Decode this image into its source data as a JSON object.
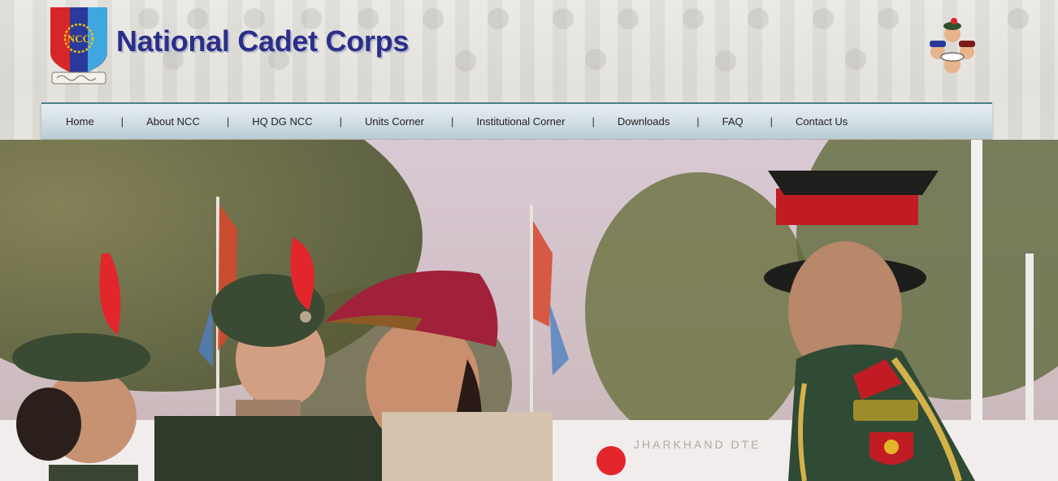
{
  "site": {
    "title": "National Cadet Corps",
    "emblem_text": "NCC"
  },
  "nav": {
    "items": [
      {
        "label": "Home"
      },
      {
        "label": "About NCC"
      },
      {
        "label": "HQ DG NCC"
      },
      {
        "label": "Units Corner"
      },
      {
        "label": "Institutional Corner"
      },
      {
        "label": "Downloads"
      },
      {
        "label": "FAQ"
      },
      {
        "label": "Contact Us"
      }
    ],
    "separator": "|"
  },
  "hero": {
    "banner_text": "JHARKHAND DTE"
  },
  "colors": {
    "title": "#2a2f8a",
    "nav_border": "#4e7f86",
    "emblem_red": "#d7262a",
    "emblem_blue": "#2b3a9a"
  }
}
